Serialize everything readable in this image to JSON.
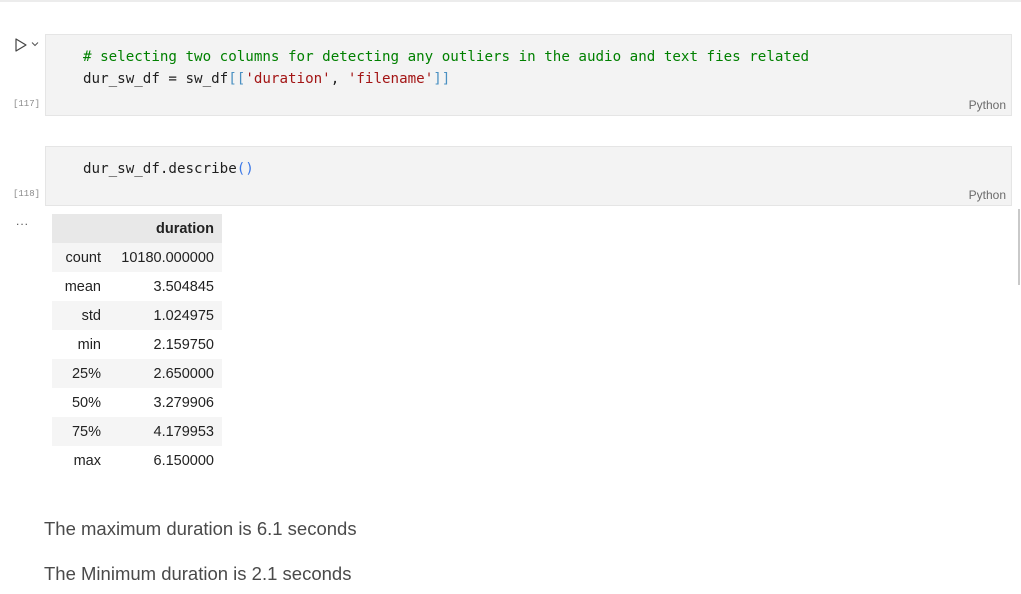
{
  "cells": [
    {
      "execution_count": "[117]",
      "language": "Python",
      "code_line_1": "# selecting two columns for detecting any outliers in the audio and text fies related",
      "code_line_2_prefix": "dur_sw_df = sw_df",
      "code_line_2_open": "[[",
      "code_line_2_str1": "'duration'",
      "code_line_2_sep": ", ",
      "code_line_2_str2": "'filename'",
      "code_line_2_close": "]]"
    },
    {
      "execution_count": "[118]",
      "language": "Python",
      "code_prefix": "dur_sw_df.describe",
      "code_parens": "()"
    }
  ],
  "output": {
    "ellipsis": "...",
    "table": {
      "columns": [
        "",
        "duration"
      ],
      "rows": [
        {
          "index": "count",
          "value": "10180.000000"
        },
        {
          "index": "mean",
          "value": "3.504845"
        },
        {
          "index": "std",
          "value": "1.024975"
        },
        {
          "index": "min",
          "value": "2.159750"
        },
        {
          "index": "25%",
          "value": "2.650000"
        },
        {
          "index": "50%",
          "value": "3.279906"
        },
        {
          "index": "75%",
          "value": "4.179953"
        },
        {
          "index": "max",
          "value": "6.150000"
        }
      ]
    }
  },
  "markdown": [
    "The maximum duration is 6.1 seconds",
    "The Minimum duration is 2.1 seconds"
  ],
  "icons": {
    "run": "run-icon",
    "expand": "chevron-down-icon"
  },
  "colors": {
    "comment": "#008000",
    "string": "#a31515",
    "cell_background": "#f3f3f3"
  }
}
